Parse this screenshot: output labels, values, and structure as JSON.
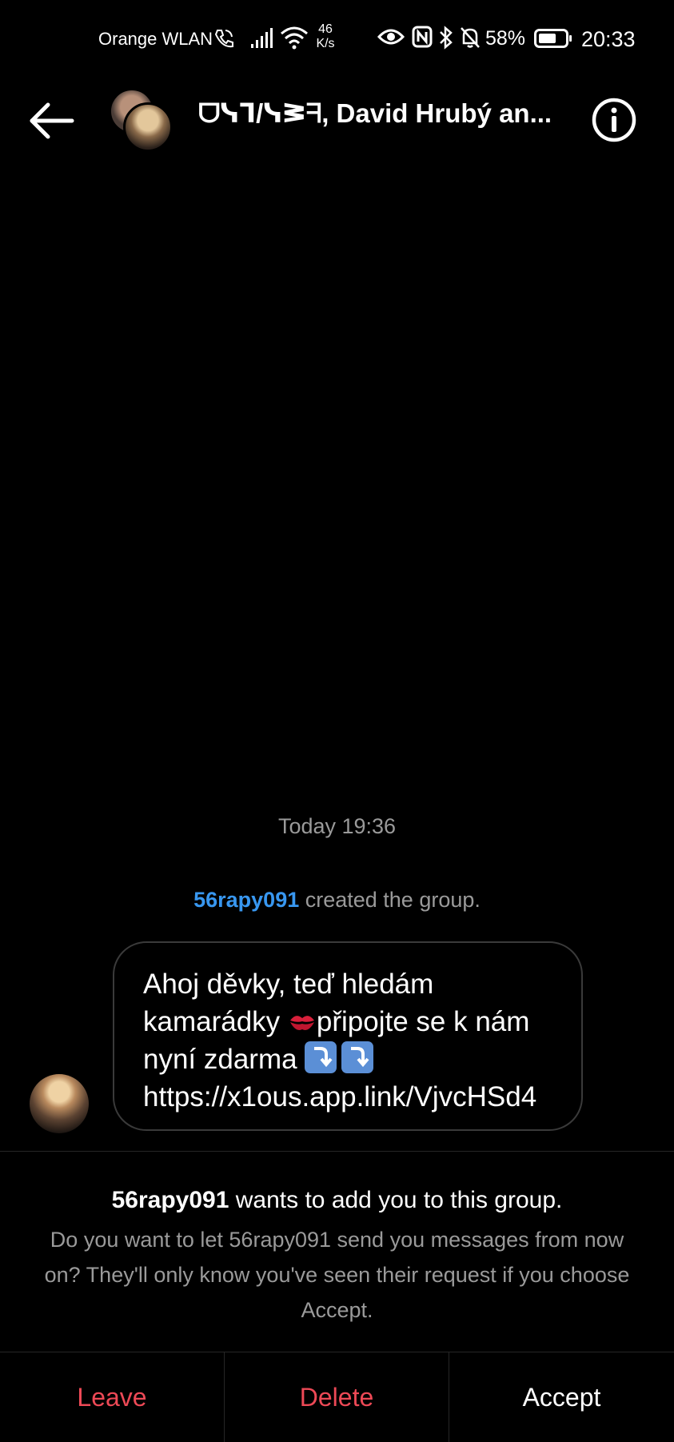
{
  "status_bar": {
    "carrier": "Orange WLAN",
    "net_speed_value": "46",
    "net_speed_unit": "K/s",
    "battery": "58%",
    "time": "20:33",
    "icons": [
      "wifi-calling-icon",
      "signal-icon",
      "wifi-icon",
      "eye-icon",
      "nfc-icon",
      "bluetooth-icon",
      "mute-icon",
      "battery-icon"
    ]
  },
  "header": {
    "title": "ᗜᓭᒣ/ᓭᕒᖷ, David Hrubý an...",
    "back_icon": "arrow-left-icon",
    "info_icon": "info-icon"
  },
  "chat": {
    "timestamp": "Today 19:36",
    "system_user": "56rapy091",
    "system_text": " created the group.",
    "message": {
      "part1": "Ahoj děvky, teď hledám kamarádky ",
      "part2": "připojte se k nám nyní zdarma ",
      "part3": " https://x1ous.app.link/VjvcHSd4"
    }
  },
  "request": {
    "title_user": "56rapy091",
    "title_text": " wants to add you to this group.",
    "body": "Do you want to let 56rapy091 send you messages from now on? They'll only know you've seen their request if you choose Accept."
  },
  "actions": {
    "leave": "Leave",
    "delete": "Delete",
    "accept": "Accept"
  },
  "colors": {
    "background": "#000000",
    "link_user": "#3897f0",
    "danger": "#ed4956",
    "muted_text": "#9a9a9a"
  }
}
